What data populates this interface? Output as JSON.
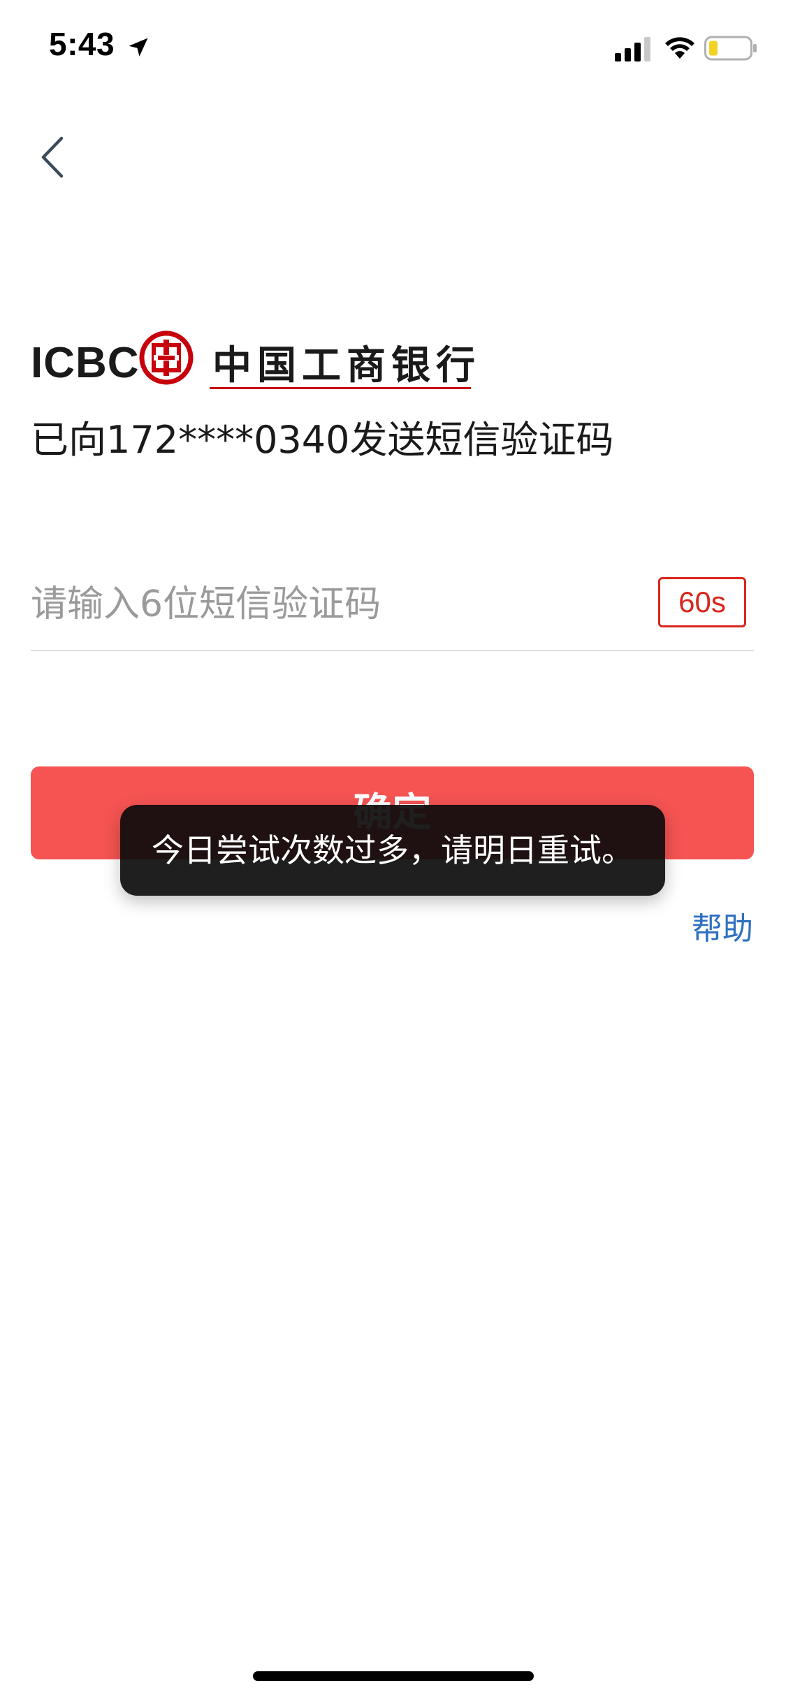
{
  "status_bar": {
    "time": "5:43",
    "icons": [
      "location-arrow-icon",
      "cellular-signal-icon",
      "wifi-icon",
      "battery-icon"
    ]
  },
  "nav": {
    "back_icon": "chevron-left-icon"
  },
  "logo": {
    "abbr": "ICBC",
    "name": "中国工商银行",
    "emblem_glyph": "工",
    "brand_color": "#c7000b"
  },
  "verification": {
    "sent_message": "已向172****0340发送短信验证码",
    "input_placeholder": "请输入6位短信验证码",
    "input_value": "",
    "countdown": "60s"
  },
  "actions": {
    "confirm_label": "确定",
    "help_label": "帮助"
  },
  "toast": {
    "message": "今日尝试次数过多，请明日重试。"
  },
  "colors": {
    "accent": "#f55453",
    "countdown": "#d9261c",
    "link": "#2e6fc1",
    "toast_bg": "#0c0c0c"
  }
}
